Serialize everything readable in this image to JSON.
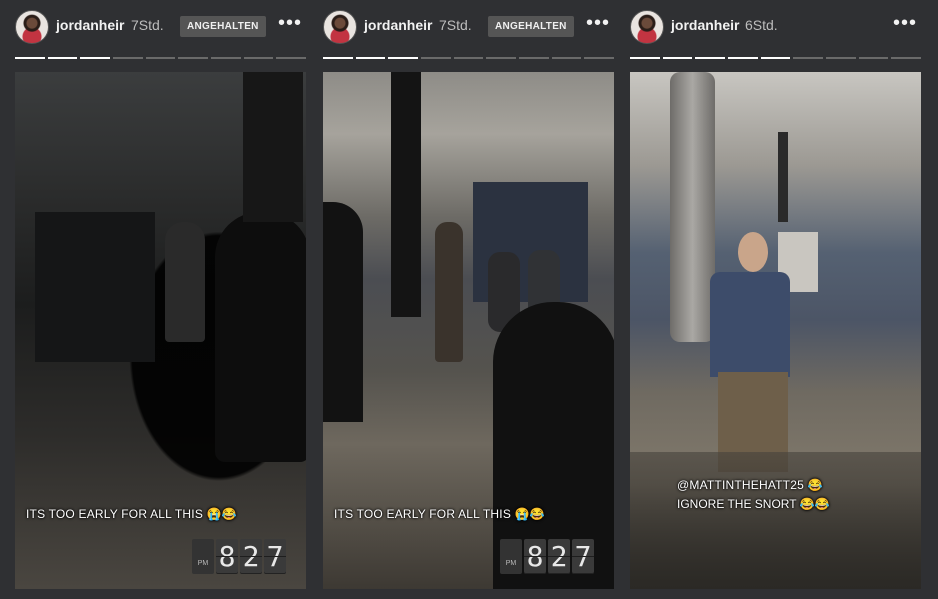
{
  "stories": [
    {
      "username": "jordanheir",
      "time": "7Std.",
      "badge": "ANGEHALTEN",
      "menu": "•••",
      "segments_total": 9,
      "segments_done": 3,
      "caption": "ITS TOO EARLY FOR ALL THIS 😭😂",
      "clock": {
        "ampm": "PM",
        "d1": "8",
        "d2": "2",
        "d3": "7"
      }
    },
    {
      "username": "jordanheir",
      "time": "7Std.",
      "badge": "ANGEHALTEN",
      "menu": "•••",
      "segments_total": 9,
      "segments_done": 3,
      "caption": "ITS TOO EARLY FOR ALL THIS 😭😂",
      "clock": {
        "ampm": "PM",
        "d1": "8",
        "d2": "2",
        "d3": "7"
      }
    },
    {
      "username": "jordanheir",
      "time": "6Std.",
      "menu": "•••",
      "segments_total": 9,
      "segments_done": 5,
      "caption_line1": "@MATTINTHEHATT25 😂",
      "caption_line2": "IGNORE THE SNORT 😂😂"
    }
  ]
}
